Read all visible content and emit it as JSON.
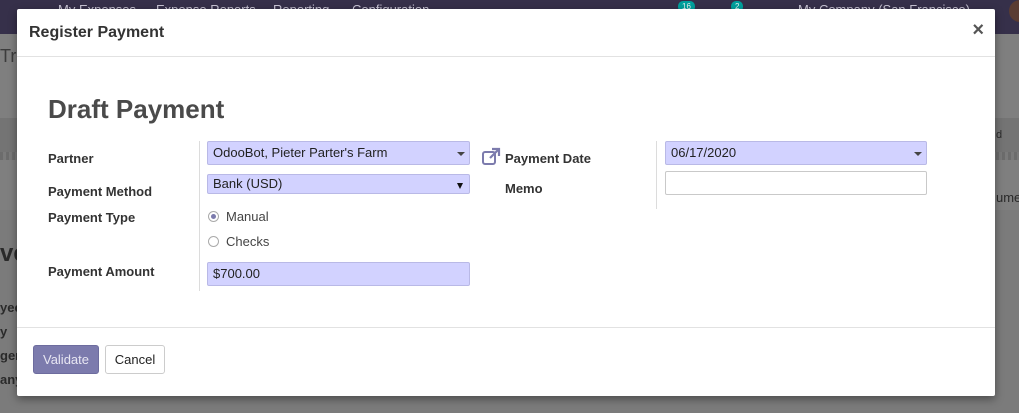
{
  "background": {
    "nav_items": [
      "My Expenses",
      "Expense Reports",
      "Reporting",
      "Configuration"
    ],
    "activity_count": "16",
    "message_count": "2",
    "company": "My Company (San Francisco)",
    "left_title_fragment": "Tra",
    "record_fragment": "ve",
    "field_fragments": [
      "yee",
      "y",
      "ger",
      "any"
    ],
    "right_fragment": "ume",
    "right_small": "d"
  },
  "dialog": {
    "title": "Register Payment",
    "close_symbol": "×",
    "record_title": "Draft Payment",
    "labels": {
      "partner": "Partner",
      "payment_method": "Payment Method",
      "payment_type": "Payment Type",
      "payment_amount": "Payment Amount",
      "payment_date": "Payment Date",
      "memo": "Memo"
    },
    "fields": {
      "partner": "OdooBot, Pieter Parter's Farm",
      "payment_method": "Bank (USD)",
      "payment_amount": "$700.00",
      "payment_date": "06/17/2020",
      "memo": ""
    },
    "payment_type_options": [
      {
        "label": "Manual",
        "selected": true
      },
      {
        "label": "Checks",
        "selected": false
      }
    ],
    "buttons": {
      "validate": "Validate",
      "cancel": "Cancel"
    }
  },
  "colors": {
    "primary": "#7c7bad",
    "required_field_bg": "#d2d2ff",
    "topbar": "#36304a"
  },
  "icons": {
    "external_link": "external-link-icon",
    "close": "close-icon"
  }
}
